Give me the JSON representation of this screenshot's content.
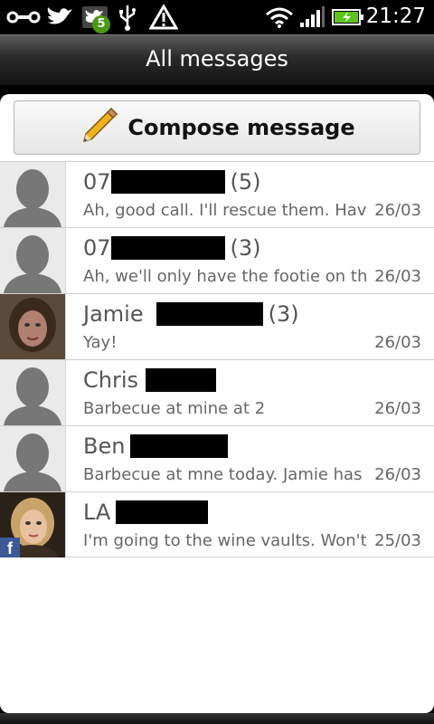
{
  "status_bar": {
    "time": "21:27",
    "notification_badge": "5",
    "icons": [
      "connector-icon",
      "twitter-bird-icon",
      "social-notification-icon",
      "usb-icon",
      "warning-icon",
      "wifi-icon",
      "signal-icon",
      "battery-charging-icon"
    ]
  },
  "title_bar": {
    "title": "All messages"
  },
  "compose": {
    "label": "Compose message",
    "icon": "pencil-icon"
  },
  "threads": [
    {
      "name": "07",
      "count": "(5)",
      "preview": "Ah, good call. I'll rescue them. Have",
      "date": "26/03",
      "avatar": "default-contact",
      "name_redacted": true
    },
    {
      "name": "07",
      "count": "(3)",
      "preview": "Ah, we'll only have the footie on th",
      "date": "26/03",
      "avatar": "default-contact",
      "name_redacted": true
    },
    {
      "name": "Jamie",
      "count": "(3)",
      "preview": "Yay!",
      "date": "26/03",
      "avatar": "photo",
      "name_redacted": true
    },
    {
      "name": "Chris",
      "count": "",
      "preview": "Barbecue at mine at 2",
      "date": "26/03",
      "avatar": "default-contact",
      "name_redacted": true
    },
    {
      "name": "Ben",
      "count": "",
      "preview": "Barbecue at mne today. Jamie has",
      "date": "26/03",
      "avatar": "default-contact",
      "name_redacted": true
    },
    {
      "name": "LA",
      "count": "",
      "preview": "I'm going to the wine vaults. Won't",
      "date": "25/03",
      "avatar": "photo-facebook",
      "name_redacted": true
    }
  ],
  "colors": {
    "badge": "#4a9a10",
    "battery": "#5cc51a",
    "divider": "#cfcfcf",
    "facebook": "#3b5998"
  }
}
